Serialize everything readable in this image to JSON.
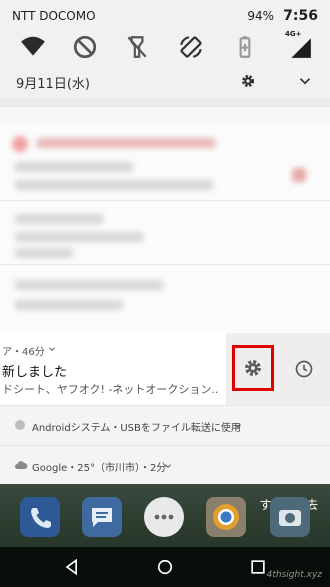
{
  "status_bar": {
    "carrier": "NTT DOCOMO",
    "battery": "94%",
    "time": "7:56"
  },
  "quick_settings": {
    "icons": [
      "wifi-icon",
      "do-not-disturb-off-icon",
      "flashlight-off-icon",
      "auto-rotate-icon",
      "battery-saver-icon",
      "signal-4g-icon"
    ],
    "signal_label": "4G+"
  },
  "date_row": {
    "date": "9月11日(水)"
  },
  "notification": {
    "app_line": "ア・46分",
    "title": "新しました",
    "text": "ドシート、ヤフオク! -ネットオークション.."
  },
  "system_rows": [
    {
      "icon": "android-system-icon",
      "text": "Androidシステム・USBをファイル転送に使用"
    },
    {
      "icon": "cloud-icon",
      "text": "Google・25°（市川市）・2分"
    }
  ],
  "home": {
    "clear_all": "すべて消去",
    "dock_apps": [
      "phone-app-icon",
      "messages-app-icon",
      "app-drawer-icon",
      "chrome-app-icon",
      "camera-app-icon"
    ]
  },
  "watermark": "4thsight.xyz",
  "colors": {
    "highlight_border": "#e00000"
  }
}
